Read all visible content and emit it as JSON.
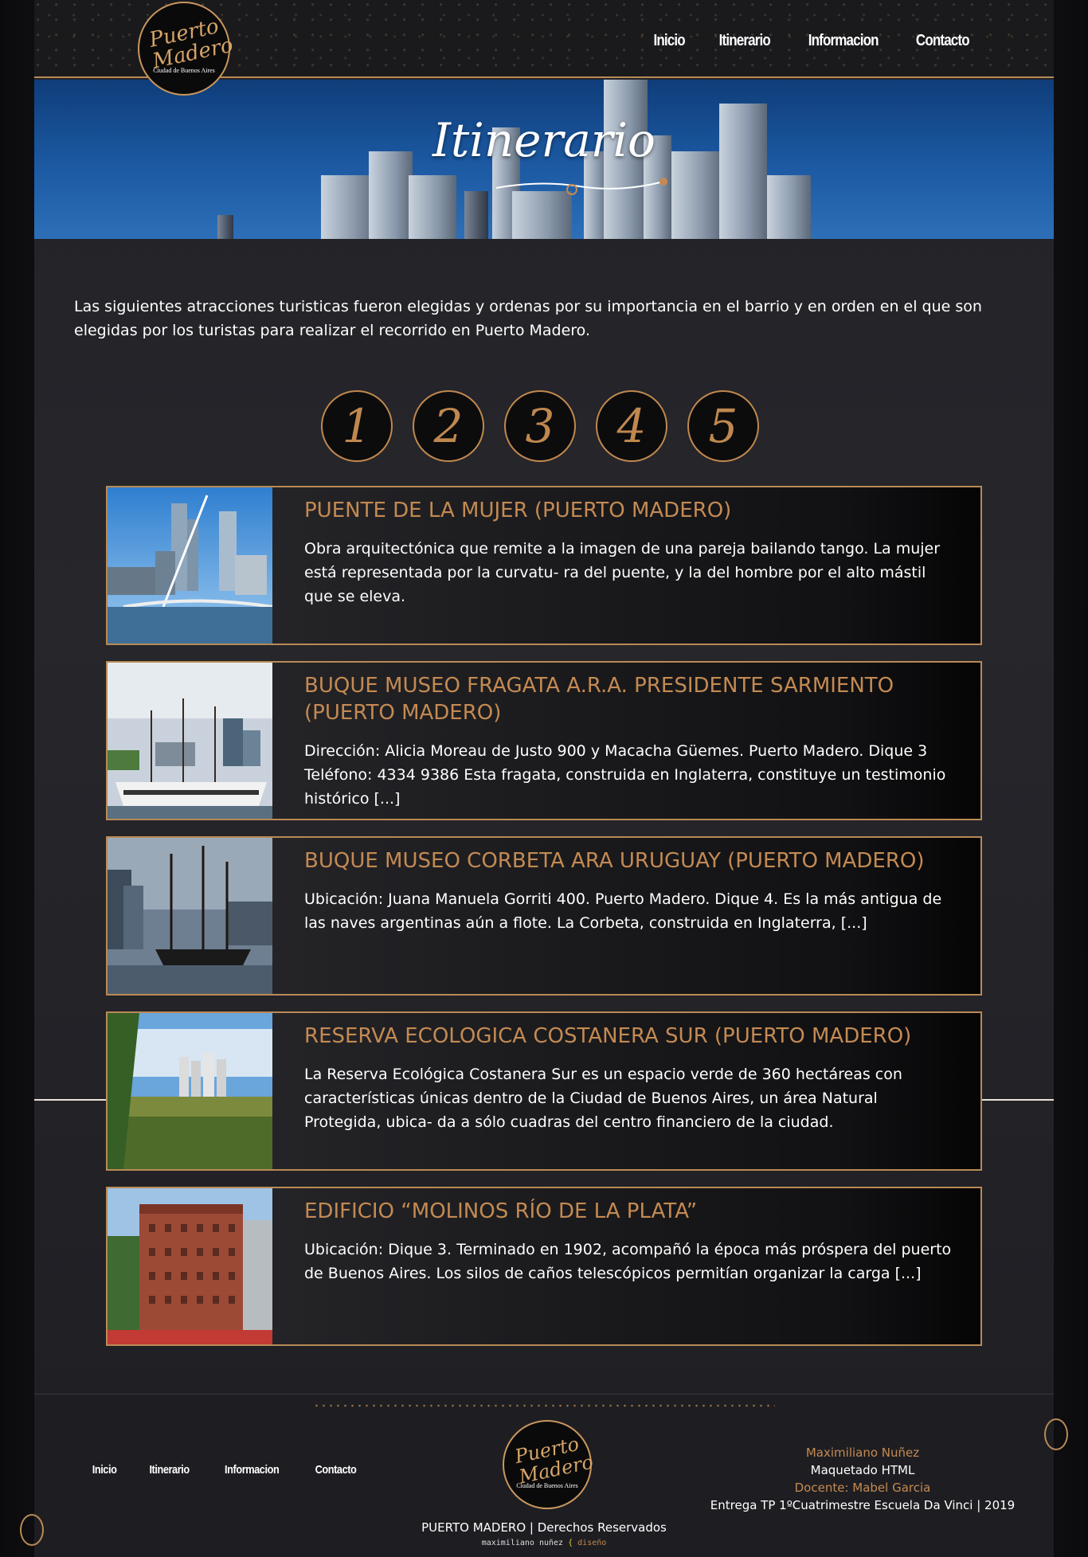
{
  "brand": {
    "line1": "Puerto",
    "line2": "Madero",
    "subtitle": "Ciudad de Buenos Aires"
  },
  "nav": [
    "Inicio",
    "Itinerario",
    "Informacion",
    "Contacto"
  ],
  "banner": {
    "title": "Itinerario"
  },
  "intro": "Las siguientes atracciones turisticas fueron elegidas y ordenas por su importancia en el barrio y en orden en el que son elegidas por los turistas para realizar el recorrido en Puerto Madero.",
  "steps": [
    "1",
    "2",
    "3",
    "4",
    "5"
  ],
  "cards": [
    {
      "title": "PUENTE DE LA MUJER (PUERTO MADERO)",
      "text": "Obra arquitectónica que remite a la imagen de una pareja bailando tango. La mujer está representada por la curvatu- ra del puente, y la del hombre por el alto mástil que se eleva."
    },
    {
      "title": "BUQUE MUSEO FRAGATA A.R.A. PRESIDENTE SARMIENTO (PUERTO MADERO)",
      "text": "Dirección: Alicia Moreau de Justo 900 y Macacha Güemes. Puerto Madero. Dique 3 Teléfono: 4334 9386 Esta fragata, construida en Inglaterra, constituye un testimonio histórico [...]"
    },
    {
      "title": "BUQUE MUSEO CORBETA ARA URUGUAY (PUERTO MADERO)",
      "text": "Ubicación: Juana Manuela Gorriti 400. Puerto Madero. Dique 4. Es la más antigua de las naves argentinas aún a flote. La Corbeta, construida en Inglaterra, [...]"
    },
    {
      "title": "RESERVA ECOLOGICA COSTANERA SUR (PUERTO MADERO)",
      "text": "La Reserva Ecológica Costanera Sur es un espacio verde de 360 hectáreas con características únicas dentro de la Ciudad de Buenos Aires, un área Natural Protegida, ubica- da a sólo cuadras del centro financiero de la ciudad."
    },
    {
      "title": "EDIFICIO “MOLINOS RÍO DE LA PLATA”",
      "text": "Ubicación: Dique 3. Terminado en 1902, acompañó la época más próspera del puerto de Buenos Aires. Los silos de caños telescópicos permitían organizar la carga [...]"
    }
  ],
  "footer": {
    "nav": [
      "Inicio",
      "Itinerario",
      "Informacion",
      "Contacto"
    ],
    "author": "Maximiliano Nuñez",
    "role": "Maquetado HTML",
    "teacher": "Docente: Mabel Garcia",
    "delivery": "Entrega TP 1ºCuatrimestre Escuela Da Vinci | 2019",
    "copyright": "PUERTO MADERO | Derechos Reservados",
    "credit_name": "maximiliano nuñez",
    "credit_brace": "{",
    "credit_word": "diseño"
  },
  "colors": {
    "accent": "#c48a52",
    "border": "#b98a55",
    "banner": "#1c5aa3"
  }
}
